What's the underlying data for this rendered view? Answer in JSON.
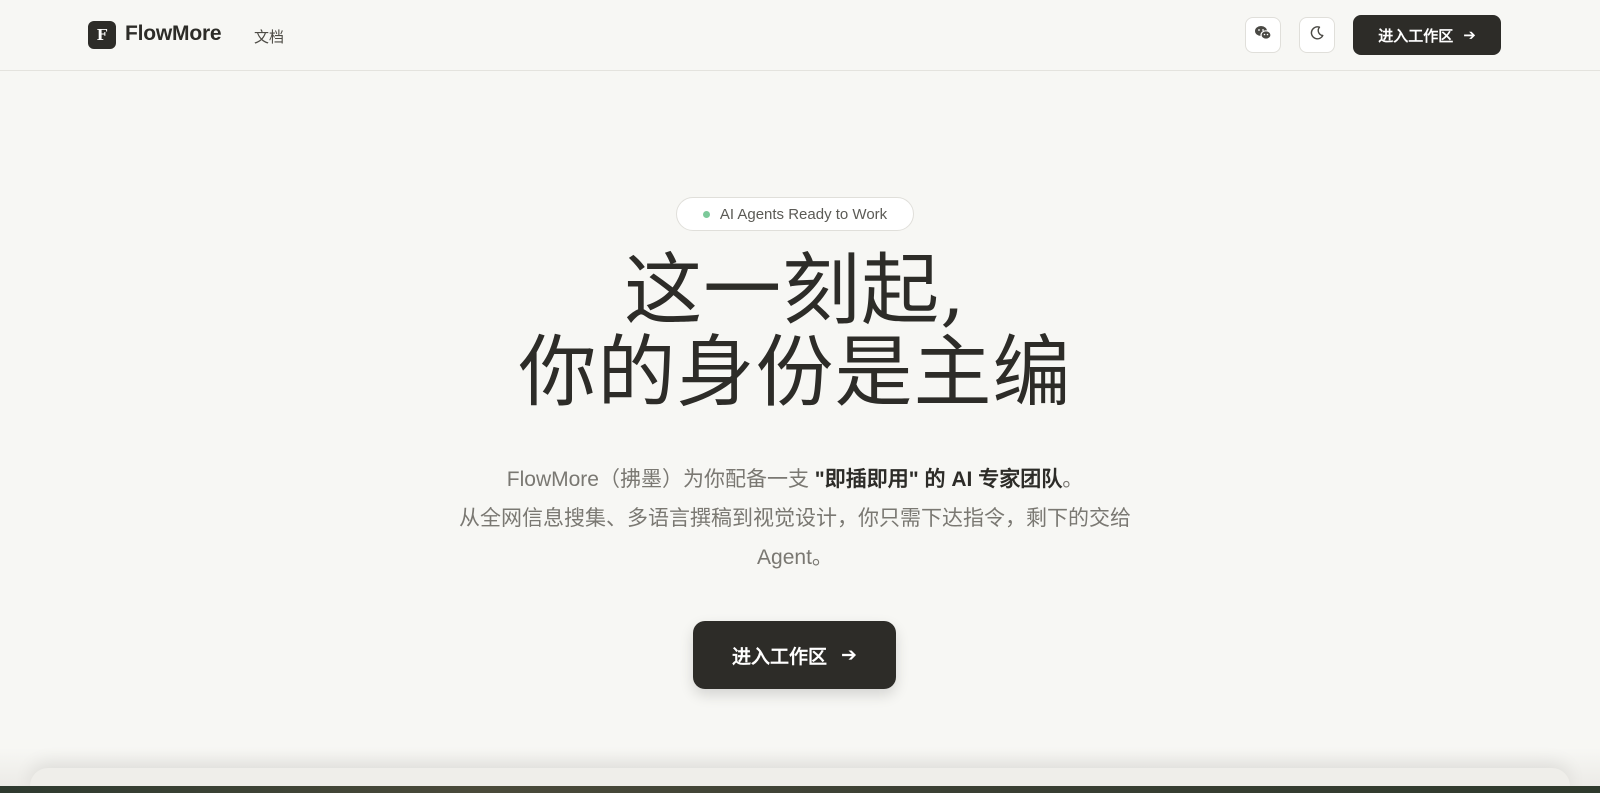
{
  "header": {
    "logo_letter": "F",
    "brand": "FlowMore",
    "nav_docs": "文档",
    "wechat_icon": "wechat-icon",
    "theme_icon": "moon-icon",
    "cta_label": "进入工作区",
    "cta_arrow": "➔"
  },
  "hero": {
    "badge_text": "AI Agents Ready to Work",
    "headline_line1": "这一刻起,",
    "headline_line2": "你的身份是主编",
    "sub_part1": "FlowMore（拂墨）为你配备一支 ",
    "sub_bold": "\"即插即用\" 的 AI 专家团队",
    "sub_part2": "。",
    "sub_line2": "从全网信息搜集、多语言撰稿到视觉设计，你只需下达指令，剩下的交给",
    "sub_line3": "Agent。",
    "cta_label": "进入工作区",
    "cta_arrow": "➔"
  },
  "colors": {
    "background": "#f7f7f4",
    "dark": "#2d2c28",
    "badge_dot": "#7cc99a",
    "muted_text": "#7a7872"
  }
}
